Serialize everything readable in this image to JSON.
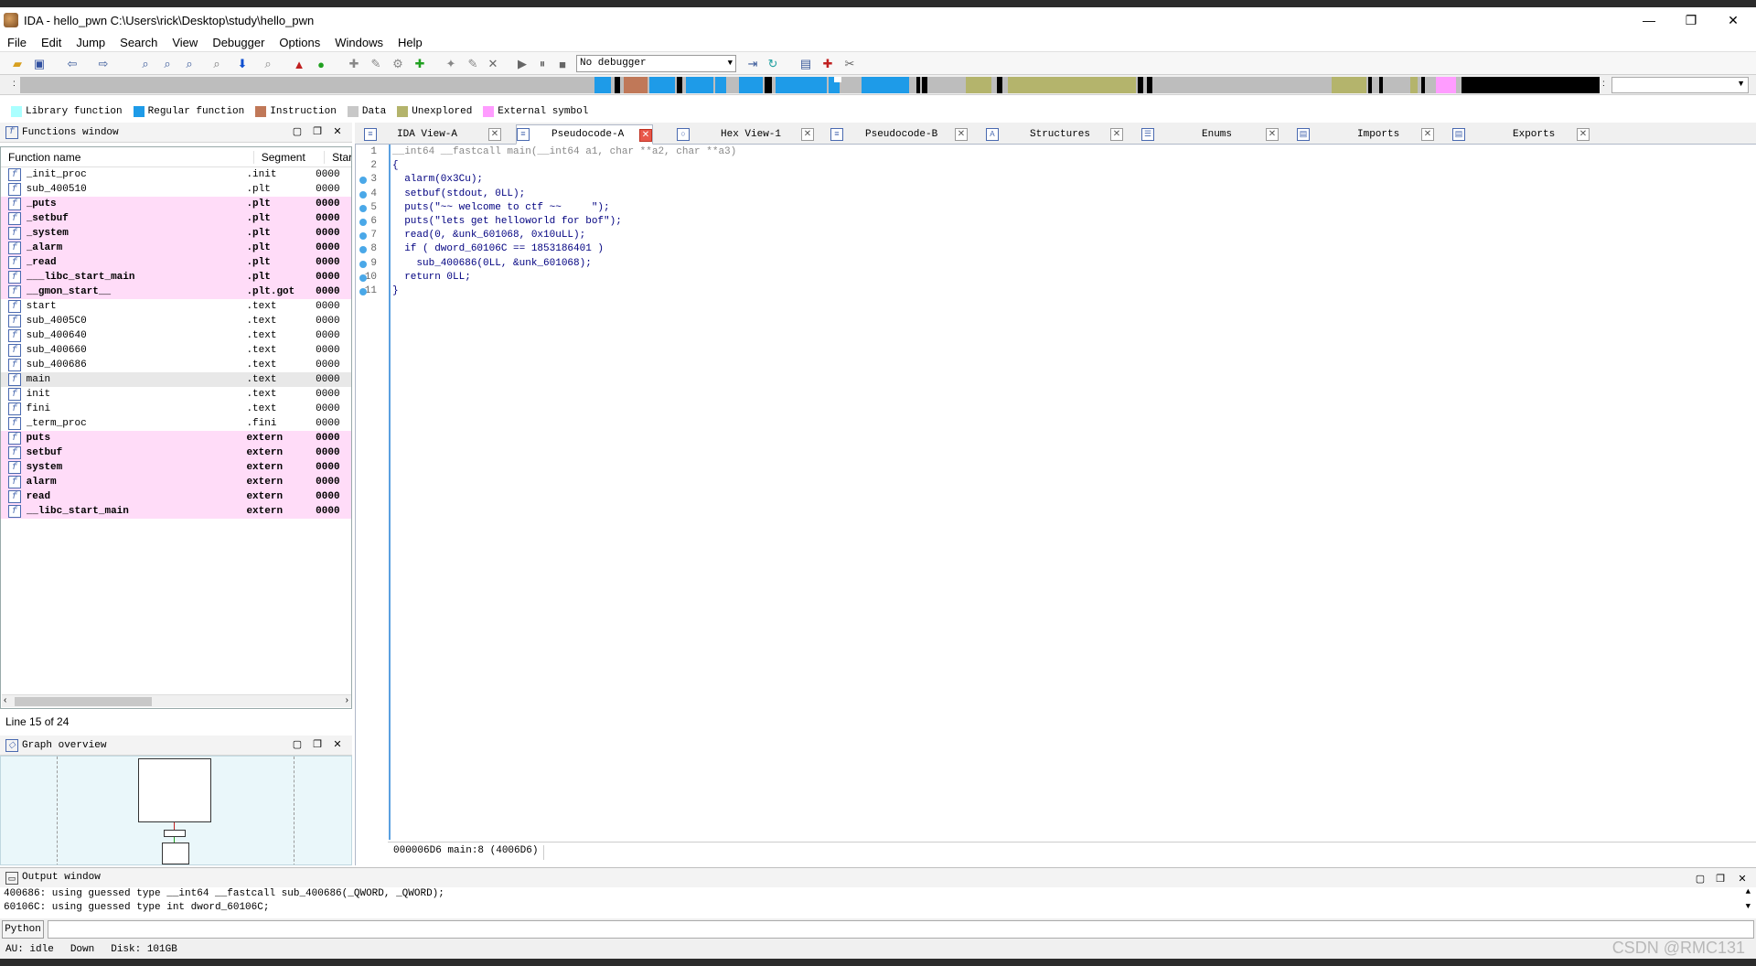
{
  "window": {
    "title": "IDA - hello_pwn C:\\Users\\rick\\Desktop\\study\\hello_pwn",
    "minimize": "—",
    "restore": "❐",
    "close": "✕"
  },
  "menu": [
    "File",
    "Edit",
    "Jump",
    "Search",
    "View",
    "Debugger",
    "Options",
    "Windows",
    "Help"
  ],
  "toolbar": {
    "debugger_select": "No debugger"
  },
  "legend": [
    {
      "label": "Library function",
      "color": "#aaffff"
    },
    {
      "label": "Regular function",
      "color": "#1e9be8"
    },
    {
      "label": "Instruction",
      "color": "#c07858"
    },
    {
      "label": "Data",
      "color": "#c8c8c8"
    },
    {
      "label": "Unexplored",
      "color": "#b4b46c"
    },
    {
      "label": "External symbol",
      "color": "#ff9cff"
    }
  ],
  "functions_window": {
    "title": "Functions window",
    "columns": [
      "Function name",
      "Segment",
      "Star"
    ],
    "rows": [
      {
        "name": "_init_proc",
        "segment": ".init",
        "start": "0000"
      },
      {
        "name": "sub_400510",
        "segment": ".plt",
        "start": "0000"
      },
      {
        "name": "_puts",
        "segment": ".plt",
        "start": "0000"
      },
      {
        "name": "_setbuf",
        "segment": ".plt",
        "start": "0000"
      },
      {
        "name": "_system",
        "segment": ".plt",
        "start": "0000"
      },
      {
        "name": "_alarm",
        "segment": ".plt",
        "start": "0000"
      },
      {
        "name": "_read",
        "segment": ".plt",
        "start": "0000"
      },
      {
        "name": "___libc_start_main",
        "segment": ".plt",
        "start": "0000"
      },
      {
        "name": "__gmon_start__",
        "segment": ".plt.got",
        "start": "0000"
      },
      {
        "name": "start",
        "segment": ".text",
        "start": "0000"
      },
      {
        "name": "sub_4005C0",
        "segment": ".text",
        "start": "0000"
      },
      {
        "name": "sub_400640",
        "segment": ".text",
        "start": "0000"
      },
      {
        "name": "sub_400660",
        "segment": ".text",
        "start": "0000"
      },
      {
        "name": "sub_400686",
        "segment": ".text",
        "start": "0000"
      },
      {
        "name": "main",
        "segment": ".text",
        "start": "0000"
      },
      {
        "name": "init",
        "segment": ".text",
        "start": "0000"
      },
      {
        "name": "fini",
        "segment": ".text",
        "start": "0000"
      },
      {
        "name": "_term_proc",
        "segment": ".fini",
        "start": "0000"
      },
      {
        "name": "puts",
        "segment": "extern",
        "start": "0000"
      },
      {
        "name": "setbuf",
        "segment": "extern",
        "start": "0000"
      },
      {
        "name": "system",
        "segment": "extern",
        "start": "0000"
      },
      {
        "name": "alarm",
        "segment": "extern",
        "start": "0000"
      },
      {
        "name": "read",
        "segment": "extern",
        "start": "0000"
      },
      {
        "name": "__libc_start_main",
        "segment": "extern",
        "start": "0000"
      }
    ],
    "status": "Line 15 of 24"
  },
  "graph_overview": {
    "title": "Graph overview"
  },
  "tabs": [
    {
      "label": "IDA View-A",
      "icon": "disasm-icon"
    },
    {
      "label": "Pseudocode-A",
      "icon": "pseudocode-icon",
      "active": true
    },
    {
      "label": "Hex View-1",
      "icon": "hex-icon"
    },
    {
      "label": "Pseudocode-B",
      "icon": "pseudocode-icon"
    },
    {
      "label": "Structures",
      "icon": "structures-icon"
    },
    {
      "label": "Enums",
      "icon": "enums-icon"
    },
    {
      "label": "Imports",
      "icon": "imports-icon"
    },
    {
      "label": "Exports",
      "icon": "exports-icon"
    }
  ],
  "code": {
    "lines": [
      {
        "n": "1",
        "text": "__int64 __fastcall main(__int64 a1, char **a2, char **a3)",
        "style": "comment",
        "dot": false
      },
      {
        "n": "2",
        "text": "{",
        "style": "code",
        "dot": false
      },
      {
        "n": "3",
        "text": "  alarm(0x3Cu);",
        "style": "code",
        "dot": true
      },
      {
        "n": "4",
        "text": "  setbuf(stdout, 0LL);",
        "style": "code",
        "dot": true
      },
      {
        "n": "5",
        "text": "  puts(\"~~ welcome to ctf ~~     \");",
        "style": "code",
        "dot": true
      },
      {
        "n": "6",
        "text": "  puts(\"lets get helloworld for bof\");",
        "style": "code",
        "dot": true
      },
      {
        "n": "7",
        "text": "  read(0, &unk_601068, 0x10uLL);",
        "style": "code",
        "dot": true
      },
      {
        "n": "8",
        "text": "  if ( dword_60106C == 1853186401 )",
        "style": "code",
        "dot": true
      },
      {
        "n": "9",
        "text": "    sub_400686(0LL, &unk_601068);",
        "style": "code",
        "dot": true
      },
      {
        "n": "10",
        "text": "  return 0LL;",
        "style": "code",
        "dot": true
      },
      {
        "n": "11",
        "text": "}",
        "style": "code",
        "dot": true
      }
    ],
    "status": "000006D6 main:8 (4006D6)"
  },
  "output_window": {
    "title": "Output window",
    "lines": [
      "400686: using guessed type __int64 __fastcall sub_400686(_QWORD, _QWORD);",
      "60106C: using guessed type int dword_60106C;"
    ]
  },
  "python": {
    "label": "Python"
  },
  "statusbar": {
    "au": "AU:  idle",
    "dir": "Down",
    "disk": "Disk: 101GB"
  },
  "watermark": "CSDN @RMC131"
}
